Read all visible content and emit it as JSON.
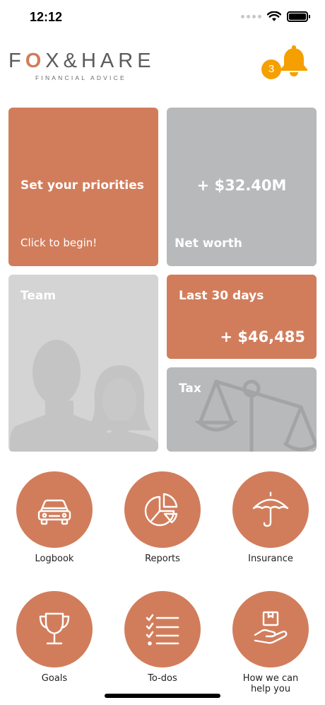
{
  "status_bar": {
    "time": "12:12"
  },
  "header": {
    "logo_pre": "F",
    "logo_o": "O",
    "logo_post": "X&HARE",
    "logo_sub": "FINANCIAL ADVICE",
    "notification_count": "3"
  },
  "tiles": {
    "priorities": {
      "title": "Set your priorities",
      "subtitle": "Click to begin!"
    },
    "networth": {
      "value": "+ $32.40M",
      "label": "Net worth"
    },
    "team": {
      "label": "Team"
    },
    "last30": {
      "label": "Last 30 days",
      "value": "+ $46,485"
    },
    "tax": {
      "label": "Tax"
    }
  },
  "menu": {
    "logbook": "Logbook",
    "reports": "Reports",
    "insurance": "Insurance",
    "goals": "Goals",
    "todos": "To-dos",
    "help_line1": "How we can",
    "help_line2": "help you"
  },
  "colors": {
    "accent": "#d17d5c",
    "tile_grey": "#b7b9ba",
    "tile_light": "#d4d4d4",
    "badge": "#f5a000"
  },
  "icons": {
    "notification": "bell-icon",
    "logbook": "car-icon",
    "reports": "pie-chart-icon",
    "insurance": "umbrella-icon",
    "goals": "trophy-icon",
    "todos": "checklist-icon",
    "help": "hand-box-icon"
  }
}
